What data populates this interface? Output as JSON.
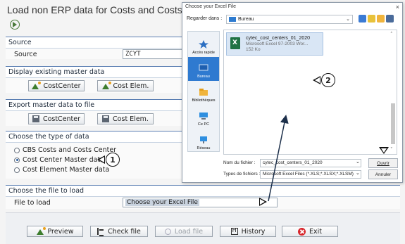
{
  "app": {
    "title": "Load non ERP data for Costs and Costs Center"
  },
  "source_group": {
    "header": "Source",
    "field_label": "Source",
    "field_value": "ZCYT"
  },
  "display_group": {
    "header": "Display existing master data",
    "btn_costcenter": "CostCenter",
    "btn_costelem": "Cost Elem."
  },
  "export_group": {
    "header": "Export master data to file",
    "btn_costcenter": "CostCenter",
    "btn_costelem": "Cost Elem."
  },
  "type_group": {
    "header": "Choose the type of data",
    "options": [
      {
        "label": "CBS Costs and Costs Center",
        "selected": false
      },
      {
        "label": "Cost Center Master data",
        "selected": true
      },
      {
        "label": "Cost Element Master data",
        "selected": false
      }
    ]
  },
  "file_group": {
    "header": "Choose the file to load",
    "field_label": "File to load",
    "field_value": "Choose your Excel File"
  },
  "bottom_buttons": {
    "preview": "Preview",
    "check": "Check file",
    "load": "Load file",
    "history": "History",
    "exit": "Exit"
  },
  "dialog": {
    "title": "Choose your Excel File",
    "close": "×",
    "look_in_label": "Regarder dans :",
    "look_in_value": "Bureau",
    "places": [
      {
        "label": "Accès rapide",
        "icon": "star-icon",
        "selected": false
      },
      {
        "label": "Bureau",
        "icon": "desktop-icon",
        "selected": true
      },
      {
        "label": "Bibliothèques",
        "icon": "library-icon",
        "selected": false
      },
      {
        "label": "Ce PC",
        "icon": "computer-icon",
        "selected": false
      },
      {
        "label": "Réseau",
        "icon": "network-icon",
        "selected": false
      }
    ],
    "file": {
      "name": "cytec_cost_centers_01_2020",
      "type": "Microsoft Excel 97-2003 Wor...",
      "size": "152 Ko"
    },
    "filename_label": "Nom du fichier :",
    "filename_value": "cytec_cost_centers_01_2020",
    "filetype_label": "Types de fichiers :",
    "filetype_value": "Microsoft Excel Files (*.XLS;*.XLSX;*.XLSM)",
    "open_button": "Ouvrir",
    "cancel_button": "Annuler"
  },
  "callouts": {
    "one": "1",
    "two": "2"
  },
  "colors": {
    "group_border": "#5b7fb3",
    "selected_place": "#2f7ad0",
    "exit_icon": "#d8262c",
    "excel_green": "#1f7244"
  }
}
